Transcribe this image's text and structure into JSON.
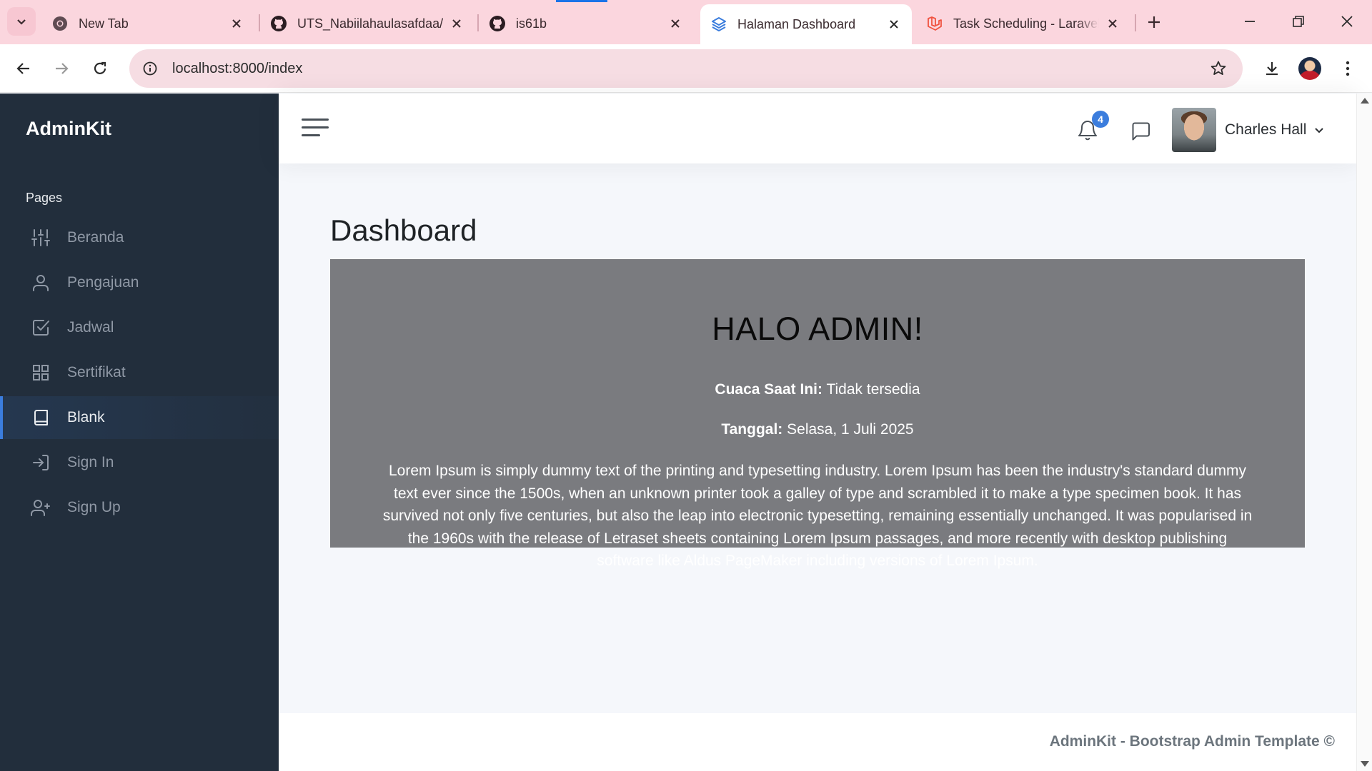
{
  "browser": {
    "tabs": [
      {
        "title": "New Tab",
        "favicon": "chrome-icon",
        "active": false
      },
      {
        "title": "UTS_Nabiilahaulasafdaa/",
        "favicon": "github-icon",
        "active": false
      },
      {
        "title": "is61b",
        "favicon": "github-icon",
        "active": false
      },
      {
        "title": "Halaman Dashboard",
        "favicon": "stack-layers-icon",
        "active": true
      },
      {
        "title": "Task Scheduling - Laravel",
        "favicon": "laravel-icon",
        "active": false
      }
    ],
    "address": "localhost:8000/index",
    "accent_color": "#fbd6de"
  },
  "sidebar": {
    "brand": "AdminKit",
    "section_header": "Pages",
    "items": [
      {
        "label": "Beranda",
        "icon": "sliders-icon",
        "active": false
      },
      {
        "label": "Pengajuan",
        "icon": "user-icon",
        "active": false
      },
      {
        "label": "Jadwal",
        "icon": "check-square-icon",
        "active": false
      },
      {
        "label": "Sertifikat",
        "icon": "grid-icon",
        "active": false
      },
      {
        "label": "Blank",
        "icon": "book-icon",
        "active": true
      },
      {
        "label": "Sign In",
        "icon": "log-in-icon",
        "active": false
      },
      {
        "label": "Sign Up",
        "icon": "user-plus-icon",
        "active": false
      }
    ],
    "bg_color": "#222e3c",
    "active_color": "#3b7ddd"
  },
  "topbar": {
    "notification_count": "4",
    "user_name": "Charles Hall"
  },
  "main": {
    "page_title": "Dashboard",
    "hero": {
      "heading": "HALO ADMIN!",
      "weather_label": "Cuaca Saat Ini:",
      "weather_value": "Tidak tersedia",
      "date_label": "Tanggal:",
      "date_value": "Selasa, 1 Juli 2025",
      "paragraph": "Lorem Ipsum is simply dummy text of the printing and typesetting industry. Lorem Ipsum has been the industry's standard dummy text ever since the 1500s, when an unknown printer took a galley of type and scrambled it to make a type specimen book. It has survived not only five centuries, but also the leap into electronic typesetting, remaining essentially unchanged. It was popularised in the 1960s with the release of Letraset sheets containing Lorem Ipsum passages, and more recently with desktop publishing software like Aldus PageMaker including versions of Lorem Ipsum."
    }
  },
  "footer": {
    "text": "AdminKit - Bootstrap Admin Template ©"
  }
}
